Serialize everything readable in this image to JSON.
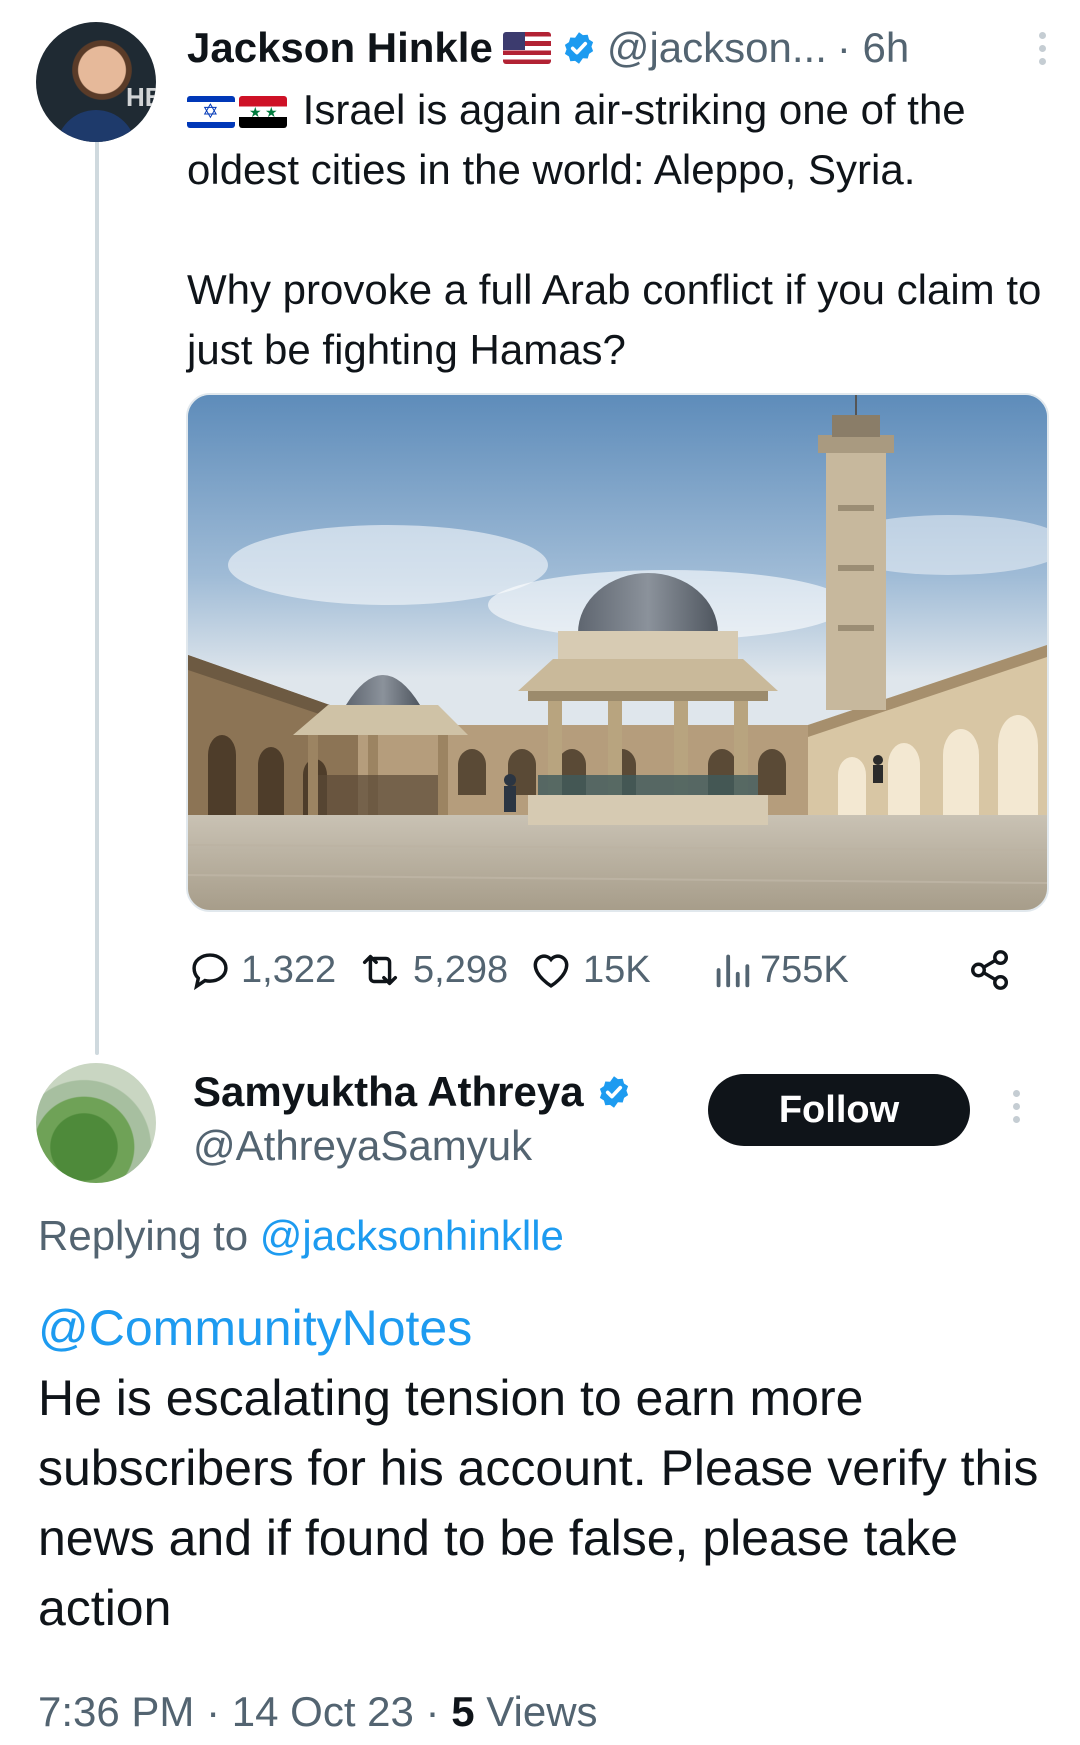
{
  "tweet": {
    "author_name": "Jackson Hinkle",
    "author_handle": "@jackson...",
    "time_ago": "· 6h",
    "flags": [
      "israel-flag",
      "syria-flag"
    ],
    "text_line1": "Israel is again air-striking one of the oldest cities in the world: Aleppo, Syria.",
    "text_line2": "Why provoke a full Arab conflict if you claim to just be fighting Hamas?",
    "media_description_icon": "mosque-photo",
    "stats": {
      "replies": "1,322",
      "reposts": "5,298",
      "likes": "15K",
      "views": "755K"
    }
  },
  "reply": {
    "author_name": "Samyuktha Athreya",
    "author_handle": "@AthreyaSamyuk",
    "follow_label": "Follow",
    "replying_prefix": "Replying to",
    "replying_to": "@jacksonhinklle",
    "mention": "@CommunityNotes",
    "text": "He is escalating tension to earn more subscribers for his account. Please verify this news and if found to be false, please take action",
    "time": "7:36 PM",
    "date": "14 Oct 23",
    "views_count": "5",
    "views_label": "Views",
    "separator": "·"
  },
  "colors": {
    "verified": "#1d9bf0",
    "link": "#1d9bf0",
    "secondary_text": "#536471",
    "primary_text": "#0f1419",
    "follow_bg": "#0f1419"
  }
}
